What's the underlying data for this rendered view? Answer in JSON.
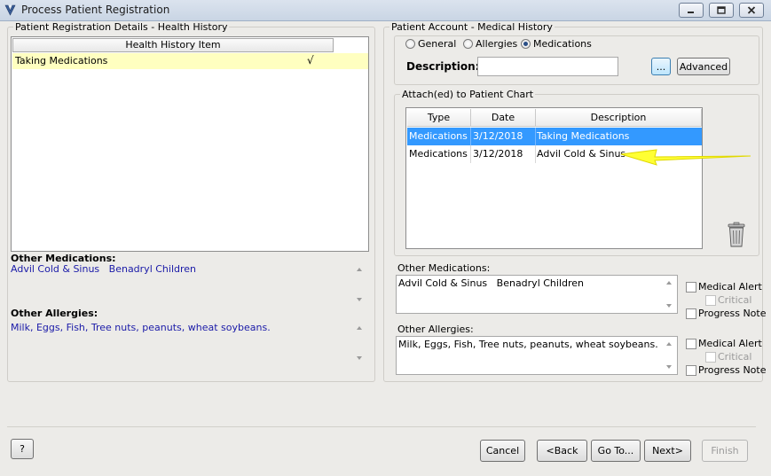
{
  "window": {
    "title": "Process Patient Registration",
    "controls": [
      "minimize",
      "maximize",
      "close"
    ]
  },
  "left_panel": {
    "title": "Patient Registration Details - Health History",
    "health_history": {
      "column_header": "Health History Item",
      "rows": [
        {
          "item": "Taking Medications",
          "checked": true,
          "check_glyph": "√"
        }
      ]
    },
    "other_medications": {
      "label": "Other Medications:",
      "value": "Advil Cold & Sinus   Benadryl Children"
    },
    "other_allergies": {
      "label": "Other Allergies:",
      "value": "Milk, Eggs, Fish, Tree nuts, peanuts, wheat soybeans."
    }
  },
  "right_panel": {
    "title": "Patient Account - Medical History",
    "filter": {
      "options": [
        "General",
        "Allergies",
        "Medications"
      ],
      "selected": "Medications"
    },
    "description": {
      "label": "Description:",
      "value": "",
      "browse_label": "...",
      "advanced_label": "Advanced"
    },
    "chart": {
      "title": "Attach(ed) to Patient Chart",
      "columns": [
        "Type",
        "Date",
        "Description"
      ],
      "rows": [
        {
          "type": "Medications",
          "date": "3/12/2018",
          "description": "Taking Medications",
          "selected": true
        },
        {
          "type": "Medications",
          "date": "3/12/2018",
          "description": "Advil Cold & Sinus",
          "selected": false
        }
      ],
      "delete_icon": "trash-can-icon",
      "annotation_arrow_color": "#ffff33"
    },
    "other_medications": {
      "label": "Other Medications:",
      "value": "Advil Cold & Sinus   Benadryl Children",
      "medical_alert_label": "Medical Alert",
      "critical_label": "Critical",
      "progress_note_label": "Progress Note"
    },
    "other_allergies": {
      "label": "Other Allergies:",
      "value": "Milk, Eggs, Fish, Tree nuts, peanuts, wheat soybeans.",
      "medical_alert_label": "Medical Alert",
      "critical_label": "Critical",
      "progress_note_label": "Progress Note"
    }
  },
  "footer": {
    "help_label": "?",
    "cancel_label": "Cancel",
    "back_label": "<Back",
    "goto_label": "Go To...",
    "next_label": "Next>",
    "finish_label": "Finish"
  },
  "colors": {
    "selection": "#3399ff",
    "highlight_row": "#ffffc0",
    "link_text": "#1a1aa8"
  }
}
